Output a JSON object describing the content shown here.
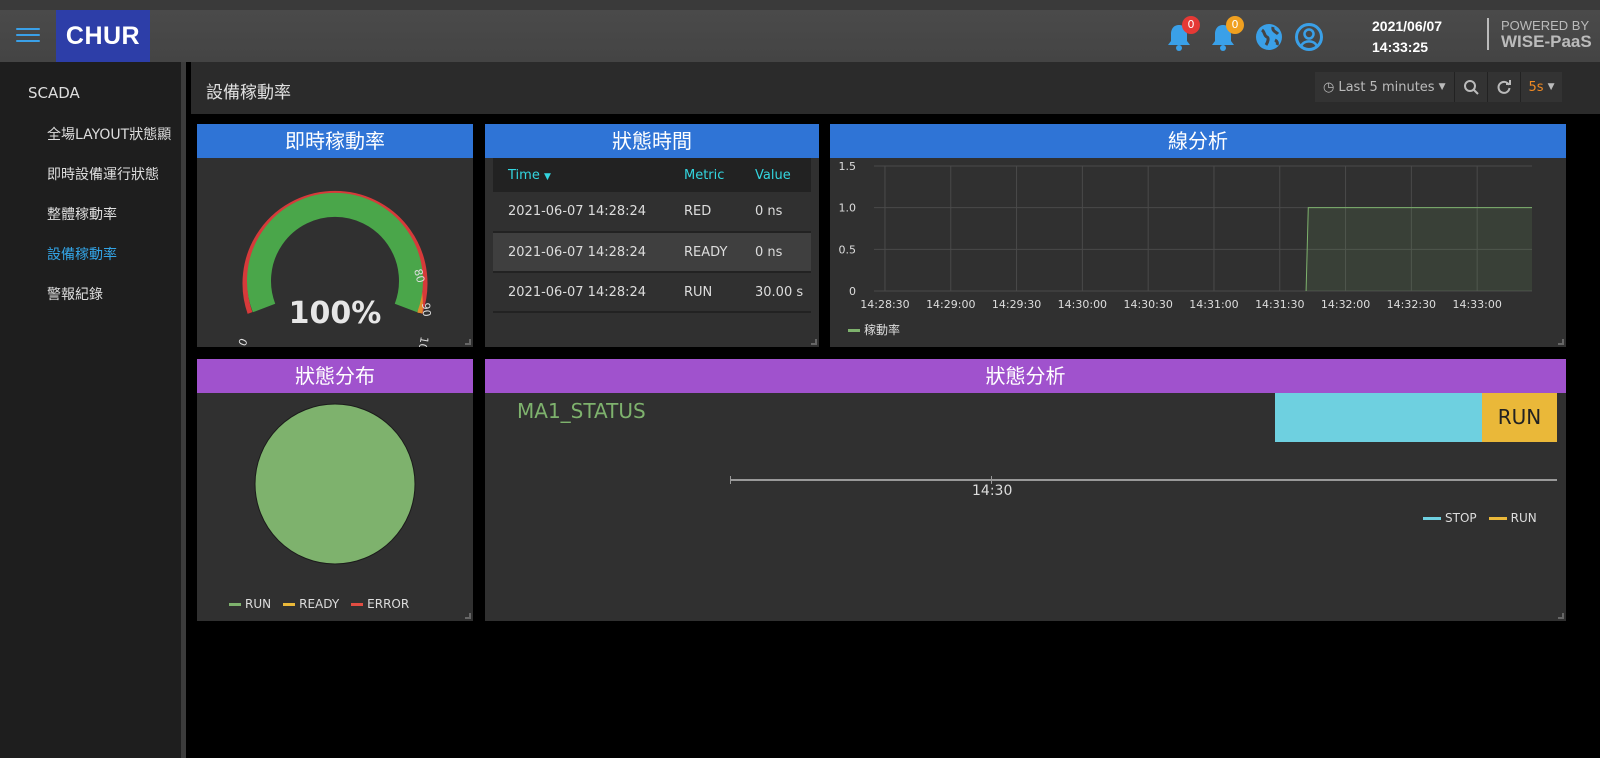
{
  "app": {
    "logo_text": "CHUR"
  },
  "header": {
    "notif_count_1": "0",
    "notif_count_2": "0",
    "date": "2021/06/07",
    "time": "14:33:25",
    "powered_by": "POWERED BY",
    "brand": "WISE-PaaS"
  },
  "sidebar": {
    "root": "SCADA",
    "items": [
      {
        "label": "全場LAYOUT狀態顯"
      },
      {
        "label": "即時設備運行狀態"
      },
      {
        "label": "整體稼動率"
      },
      {
        "label": "設備稼動率",
        "active": true
      },
      {
        "label": "警報紀錄"
      }
    ]
  },
  "page": {
    "title": "設備稼動率",
    "time_range": "Last 5 minutes",
    "refresh": "5s"
  },
  "gauge": {
    "title": "即時稼動率",
    "value_text": "100%",
    "value": 100,
    "ticks": [
      "0",
      "80",
      "90",
      "100"
    ]
  },
  "state_time": {
    "title": "狀態時間",
    "columns": [
      "Time",
      "Metric",
      "Value"
    ],
    "rows": [
      [
        "2021-06-07 14:28:24",
        "RED",
        "0 ns"
      ],
      [
        "2021-06-07 14:28:24",
        "READY",
        "0 ns"
      ],
      [
        "2021-06-07 14:28:24",
        "RUN",
        "30.00 s"
      ]
    ]
  },
  "line_panel": {
    "title": "線分析",
    "legend": "稼動率"
  },
  "pie_panel": {
    "title": "狀態分布",
    "legend": [
      "RUN",
      "READY",
      "ERROR"
    ]
  },
  "status_panel": {
    "title": "狀態分析",
    "series_label": "MA1_STATUS",
    "bar_label": "RUN",
    "axis_tick": "14:30",
    "legend": [
      "STOP",
      "RUN"
    ]
  },
  "colors": {
    "blue_head": "#2f74d6",
    "purple_head": "#a052cd",
    "green": "#7eb26d",
    "yellow": "#eab839",
    "red": "#e24d42",
    "cyan": "#6ed0e0"
  },
  "chart_data": [
    {
      "type": "line",
      "title": "線分析",
      "x": [
        "14:28:30",
        "14:29:00",
        "14:29:30",
        "14:30:00",
        "14:30:30",
        "14:31:00",
        "14:31:30",
        "14:32:00",
        "14:32:30",
        "14:33:00"
      ],
      "series": [
        {
          "name": "稼動率",
          "points": [
            [
              "14:31:42",
              0
            ],
            [
              "14:31:43",
              1.0
            ],
            [
              "14:33:25",
              1.0
            ]
          ]
        }
      ],
      "yticks": [
        "0",
        "0.5",
        "1.0",
        "1.5"
      ],
      "ylim": [
        0,
        1.5
      ],
      "xlim": [
        "14:28:25",
        "14:33:25"
      ],
      "grid": true,
      "legend_position": "bottom-left"
    },
    {
      "type": "pie",
      "title": "狀態分布",
      "slices": [
        {
          "label": "RUN",
          "value": 100
        },
        {
          "label": "READY",
          "value": 0
        },
        {
          "label": "ERROR",
          "value": 0
        }
      ],
      "legend_position": "bottom"
    }
  ]
}
